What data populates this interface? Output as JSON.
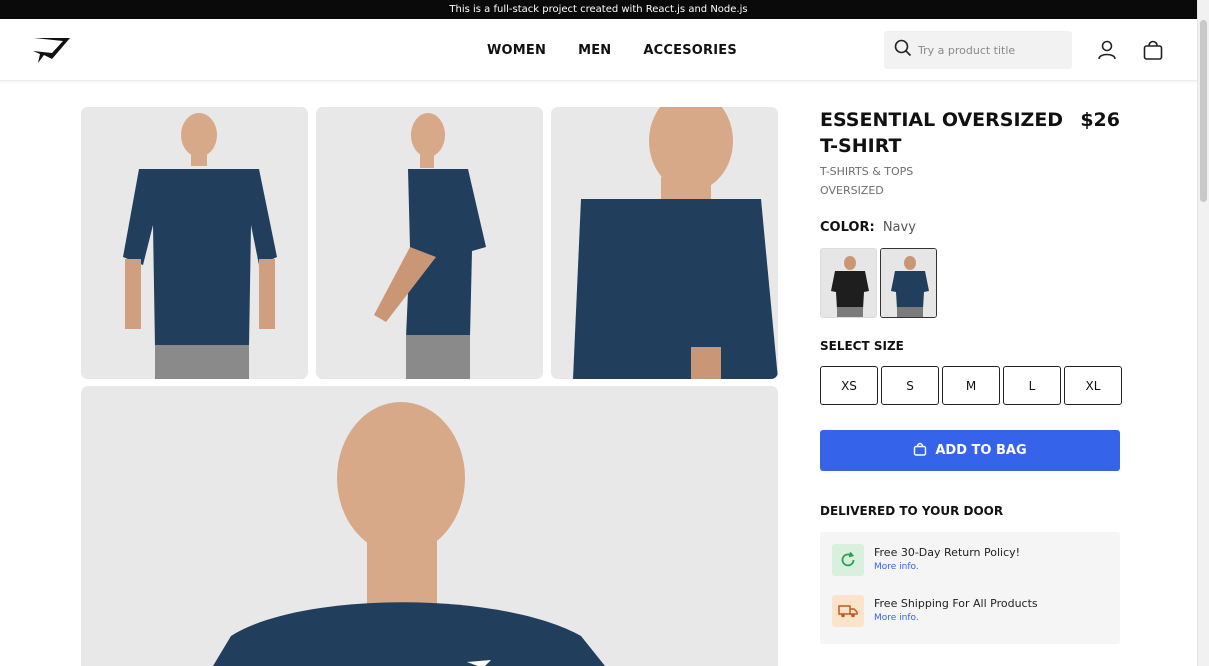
{
  "announcement": "This is a full-stack project created with React.js and Node.js",
  "nav": {
    "items": [
      "WOMEN",
      "MEN",
      "ACCESORIES"
    ]
  },
  "search": {
    "placeholder": "Try a product title",
    "value": ""
  },
  "product": {
    "title": "ESSENTIAL OVERSIZED T-SHIRT",
    "price": "$26",
    "category": "T-SHIRTS & TOPS",
    "fit": "OVERSIZED",
    "color_label": "COLOR:",
    "color_value": "Navy",
    "size_label": "SELECT SIZE",
    "sizes": [
      "XS",
      "S",
      "M",
      "L",
      "XL"
    ],
    "add_to_bag": "ADD TO BAG"
  },
  "delivery": {
    "title": "DELIVERED TO YOUR DOOR",
    "items": [
      {
        "text": "Free 30-Day Return Policy!",
        "link": "More info.",
        "icon": "refresh-icon"
      },
      {
        "text": "Free Shipping For All Products",
        "link": "More info.",
        "icon": "truck-icon"
      }
    ]
  },
  "colors": {
    "shirt_navy": "#213f5c",
    "accent_blue": "#3563e9",
    "return_icon_bg": "#d7f1de",
    "shipping_icon_bg": "#fbe4cb"
  }
}
